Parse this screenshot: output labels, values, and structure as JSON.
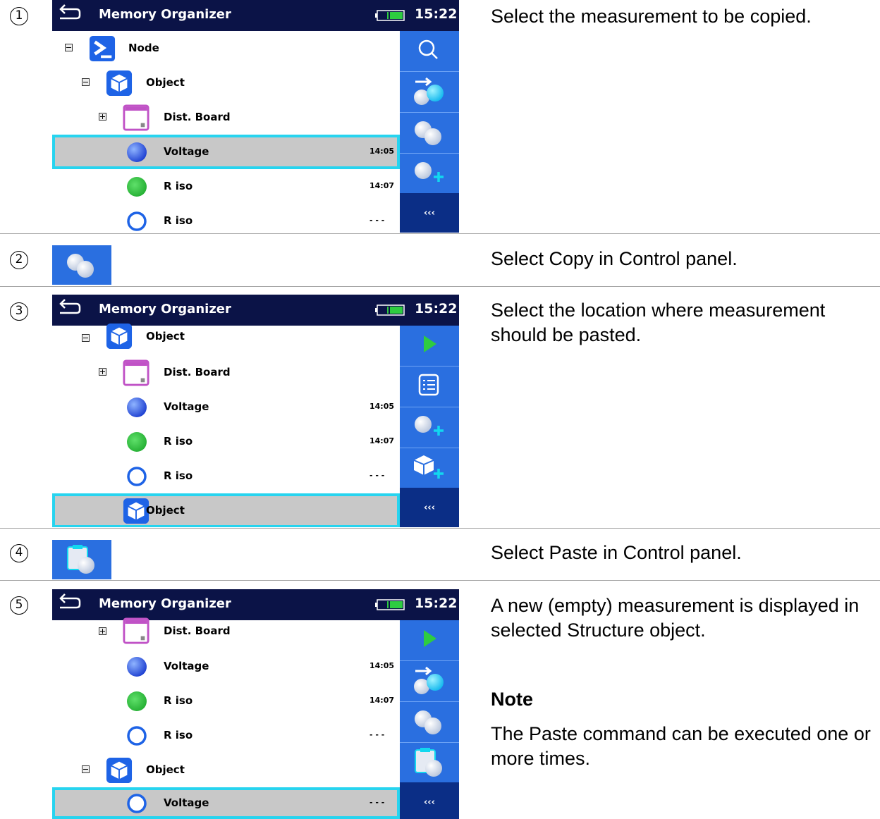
{
  "steps": [
    {
      "num": "1",
      "text": "Select the measurement to be copied."
    },
    {
      "num": "2",
      "text": "Select Copy in Control panel."
    },
    {
      "num": "3",
      "text": "Select the location where measurement should be pasted."
    },
    {
      "num": "4",
      "text": "Select Paste in Control panel."
    },
    {
      "num": "5",
      "text": "A new (empty) measurement is displayed in selected Structure object.",
      "note_title": "Note",
      "note_text": "The Paste command can be executed one or more times."
    }
  ],
  "screen": {
    "title": "Memory Organizer",
    "time": "15:22",
    "back_more": "‹‹‹"
  },
  "screen1": {
    "rows": [
      {
        "label": "Node"
      },
      {
        "label": "Object"
      },
      {
        "label": "Dist. Board"
      },
      {
        "label": "Voltage",
        "time": "14:05"
      },
      {
        "label": "R iso",
        "time": "14:07"
      },
      {
        "label": "R iso",
        "time": "- - -"
      }
    ]
  },
  "screen3": {
    "rows": [
      {
        "label": "Object"
      },
      {
        "label": "Dist. Board"
      },
      {
        "label": "Voltage",
        "time": "14:05"
      },
      {
        "label": "R iso",
        "time": "14:07"
      },
      {
        "label": "R iso",
        "time": "- - -"
      },
      {
        "label": "Object"
      }
    ]
  },
  "screen5": {
    "rows": [
      {
        "label": "Dist. Board"
      },
      {
        "label": "Voltage",
        "time": "14:05"
      },
      {
        "label": "R iso",
        "time": "14:07"
      },
      {
        "label": "R iso",
        "time": "- - -"
      },
      {
        "label": "Object"
      },
      {
        "label": "Voltage",
        "time": "- - -"
      }
    ]
  },
  "colors": {
    "header": "#0b1347",
    "panel": "#2a6fe0",
    "selection": "#27d4ef"
  }
}
